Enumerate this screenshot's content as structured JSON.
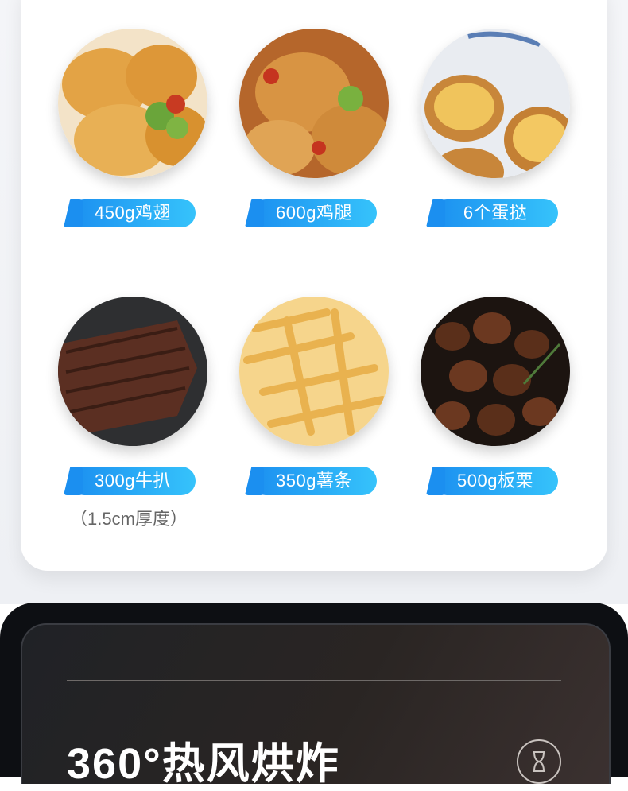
{
  "foods": [
    {
      "label": "450g鸡翅",
      "icon": "chicken-wings-photo"
    },
    {
      "label": "600g鸡腿",
      "icon": "chicken-legs-photo"
    },
    {
      "label": "6个蛋挞",
      "icon": "egg-tarts-photo"
    },
    {
      "label": "300g牛扒",
      "note": "（1.5cm厚度）",
      "icon": "steak-photo"
    },
    {
      "label": "350g薯条",
      "icon": "french-fries-photo"
    },
    {
      "label": "500g板栗",
      "icon": "chestnuts-photo"
    }
  ],
  "feature": {
    "title": "360°热风烘炸",
    "icon": "hourglass-icon"
  },
  "colors": {
    "pill_start": "#1b8ff0",
    "pill_end": "#36c3fb",
    "dark_bg": "#0d0f13"
  }
}
